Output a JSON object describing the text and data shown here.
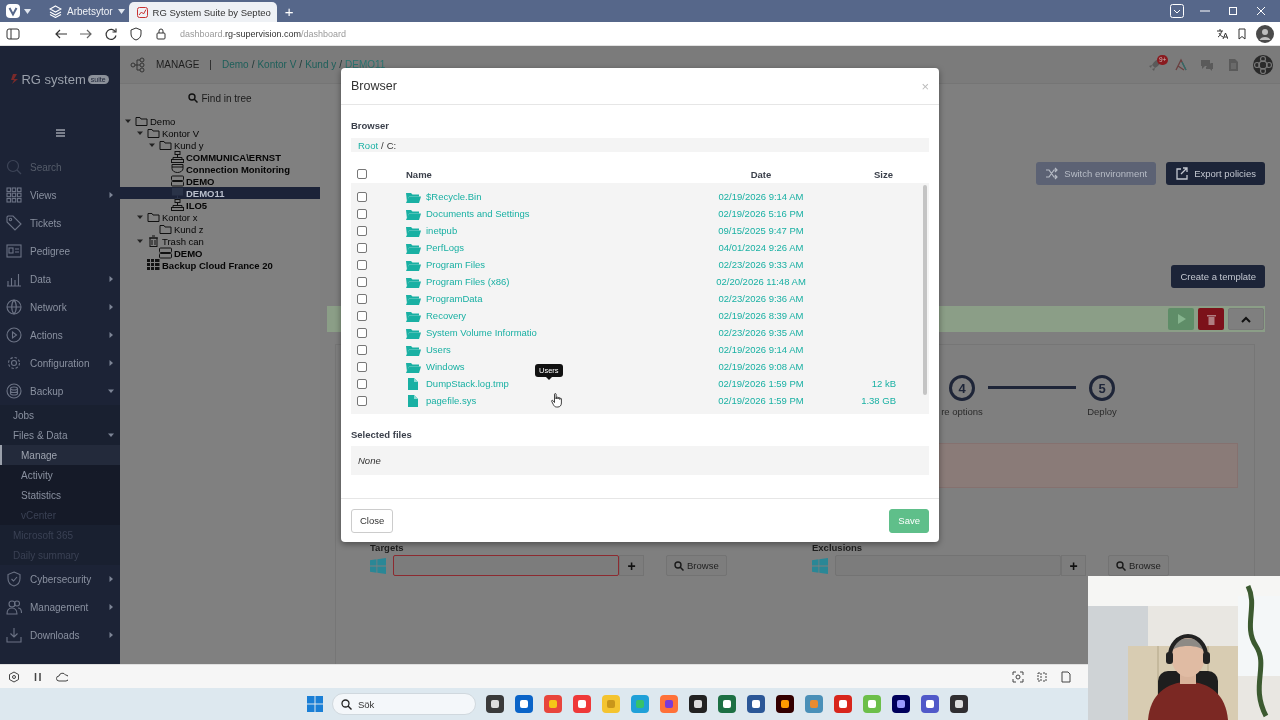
{
  "browser": {
    "workspace": "Arbetsytor",
    "tabs": [
      {
        "title": "RG System Suite by Septeo",
        "selected": true
      }
    ],
    "new_tab": "+",
    "url": {
      "subdomain": "dashboard.",
      "domain": "rg-supervision.com",
      "path": "/dashboard"
    }
  },
  "sidebar": {
    "logo": "RG system",
    "logo_badge": "suite",
    "search": {
      "placeholder": "Search"
    },
    "items": [
      {
        "label": "Views",
        "selected": false,
        "expanded": false
      },
      {
        "label": "Tickets",
        "selected": false
      },
      {
        "label": "Pedigree",
        "selected": false
      },
      {
        "label": "Data",
        "selected": false,
        "expanded": false
      },
      {
        "label": "Network",
        "selected": false,
        "expanded": false
      },
      {
        "label": "Actions",
        "selected": false,
        "expanded": false
      },
      {
        "label": "Configuration",
        "selected": false,
        "expanded": false
      },
      {
        "label": "Backup",
        "selected": false,
        "expanded": true,
        "children": [
          {
            "label": "Jobs",
            "selected": false,
            "disabled": false
          },
          {
            "label": "Files & Data",
            "selected": false,
            "disabled": false,
            "expanded": true,
            "children": [
              {
                "label": "Manage",
                "selected": true,
                "disabled": false
              },
              {
                "label": "Activity",
                "selected": false,
                "disabled": false
              },
              {
                "label": "Statistics",
                "selected": false,
                "disabled": false
              },
              {
                "label": "vCenter",
                "selected": false,
                "disabled": true
              }
            ]
          },
          {
            "label": "Microsoft 365",
            "selected": false,
            "disabled": true
          },
          {
            "label": "Daily summary",
            "selected": false,
            "disabled": true
          }
        ]
      },
      {
        "label": "Cybersecurity",
        "selected": false,
        "expanded": false
      },
      {
        "label": "Management",
        "selected": false,
        "expanded": false
      },
      {
        "label": "Downloads",
        "selected": false,
        "expanded": false
      }
    ]
  },
  "header": {
    "section": "MANAGE",
    "separator": "|",
    "breadcrumb_separator": "/",
    "breadcrumb": [
      {
        "label": "Demo",
        "current": false
      },
      {
        "label": "Kontor V",
        "current": false
      },
      {
        "label": "Kund y",
        "current": false
      },
      {
        "label": "DEMO11",
        "current": true
      }
    ],
    "notification_badge": "9+"
  },
  "tree": {
    "search_label": "Find in tree",
    "nodes": [
      {
        "label": "Demo",
        "kind": "folder",
        "selected": false,
        "expanded": true,
        "children": [
          {
            "label": "Kontor V",
            "kind": "folder",
            "selected": false,
            "expanded": true,
            "children": [
              {
                "label": "Kund y",
                "kind": "folder",
                "selected": false,
                "expanded": true,
                "children": [
                  {
                    "label": "COMMUNICA\\ERNST",
                    "kind": "agent",
                    "selected": false
                  },
                  {
                    "label": "Connection Monitoring",
                    "kind": "monitor",
                    "selected": false
                  },
                  {
                    "label": "DEMO",
                    "kind": "server",
                    "selected": false
                  },
                  {
                    "label": "DEMO11",
                    "kind": "desktop",
                    "selected": true
                  },
                  {
                    "label": "ILO5",
                    "kind": "agent",
                    "selected": false
                  }
                ]
              }
            ]
          },
          {
            "label": "Kontor x",
            "kind": "folder",
            "selected": false,
            "expanded": true,
            "children": [
              {
                "label": "Kund z",
                "kind": "folder",
                "selected": false
              }
            ]
          },
          {
            "label": "Trash can",
            "kind": "trash",
            "selected": false,
            "expanded": true,
            "children": [
              {
                "label": "DEMO",
                "kind": "server",
                "selected": false
              }
            ]
          },
          {
            "label": "Backup Cloud France 20",
            "kind": "cloud",
            "selected": false
          }
        ]
      }
    ]
  },
  "main": {
    "toolbar_buttons": [
      {
        "label": "Switch environment",
        "kind": "secondary"
      },
      {
        "label": "Export policies",
        "kind": "primary"
      }
    ],
    "template_button": "Create a template",
    "steps": [
      {
        "number": "4",
        "label": "re options"
      },
      {
        "number": "5",
        "label": "Deploy"
      }
    ],
    "fields": [
      {
        "label": "Targets",
        "invalid": true,
        "add": "+",
        "browse": "Browse"
      },
      {
        "label": "Exclusions",
        "invalid": false,
        "add": "+",
        "browse": "Browse"
      }
    ]
  },
  "dialog": {
    "title": "Browser",
    "close": "×",
    "section": "Browser",
    "path": [
      {
        "label": "Root",
        "link": true
      },
      {
        "label": "C:",
        "link": false
      }
    ],
    "path_separator": "/",
    "select_all": {
      "checked": false
    },
    "columns": [
      "Name",
      "Date",
      "Size"
    ],
    "rows": [
      {
        "name": "$Recycle.Bin",
        "kind": "folder",
        "date": "02/19/2026 9:14 AM",
        "checked": false
      },
      {
        "name": "Documents and Settings",
        "kind": "folder",
        "date": "02/19/2026 5:16 PM",
        "checked": false
      },
      {
        "name": "inetpub",
        "kind": "folder",
        "date": "09/15/2025 9:47 PM",
        "checked": false
      },
      {
        "name": "PerfLogs",
        "kind": "folder",
        "date": "04/01/2024 9:26 AM",
        "checked": false
      },
      {
        "name": "Program Files",
        "kind": "folder",
        "date": "02/23/2026 9:33 AM",
        "checked": false
      },
      {
        "name": "Program Files (x86)",
        "kind": "folder",
        "date": "02/20/2026 11:48 AM",
        "checked": false
      },
      {
        "name": "ProgramData",
        "kind": "folder",
        "date": "02/23/2026 9:36 AM",
        "checked": false
      },
      {
        "name": "Recovery",
        "kind": "folder",
        "date": "02/19/2026 8:39 AM",
        "checked": false
      },
      {
        "name": "System Volume Informatio",
        "kind": "folder",
        "date": "02/23/2026 9:35 AM",
        "checked": false
      },
      {
        "name": "Users",
        "kind": "folder",
        "date": "02/19/2026 9:14 AM",
        "checked": false
      },
      {
        "name": "Windows",
        "kind": "folder",
        "date": "02/19/2026 9:08 AM",
        "checked": false
      },
      {
        "name": "DumpStack.log.tmp",
        "kind": "file",
        "date": "02/19/2026 1:59 PM",
        "size": "12 kB",
        "checked": false
      },
      {
        "name": "pagefile.sys",
        "kind": "file",
        "date": "02/19/2026 1:59 PM",
        "size": "1.38 GB",
        "checked": false
      }
    ],
    "tooltip": "Users",
    "selected_title": "Selected files",
    "selected_value": "None",
    "buttons": [
      {
        "label": "Close",
        "kind": "default",
        "disabled": false
      },
      {
        "label": "Save",
        "kind": "primary",
        "disabled": true
      }
    ]
  },
  "taskbar": {
    "search": {
      "placeholder": "Sök"
    }
  }
}
